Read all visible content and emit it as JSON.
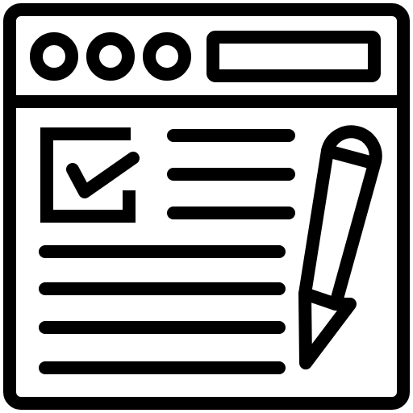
{
  "icon": {
    "name": "web-form-checklist-edit-icon",
    "stroke_color": "#000000",
    "background_color": "#ffffff",
    "parts": {
      "window": "browser-window-icon",
      "window_dots": [
        "window-dot-icon",
        "window-dot-icon",
        "window-dot-icon"
      ],
      "address_bar": "address-bar-icon",
      "checkbox": "checked-checkbox-icon",
      "pencil": "pencil-icon",
      "text_lines": "text-lines-icon"
    }
  }
}
